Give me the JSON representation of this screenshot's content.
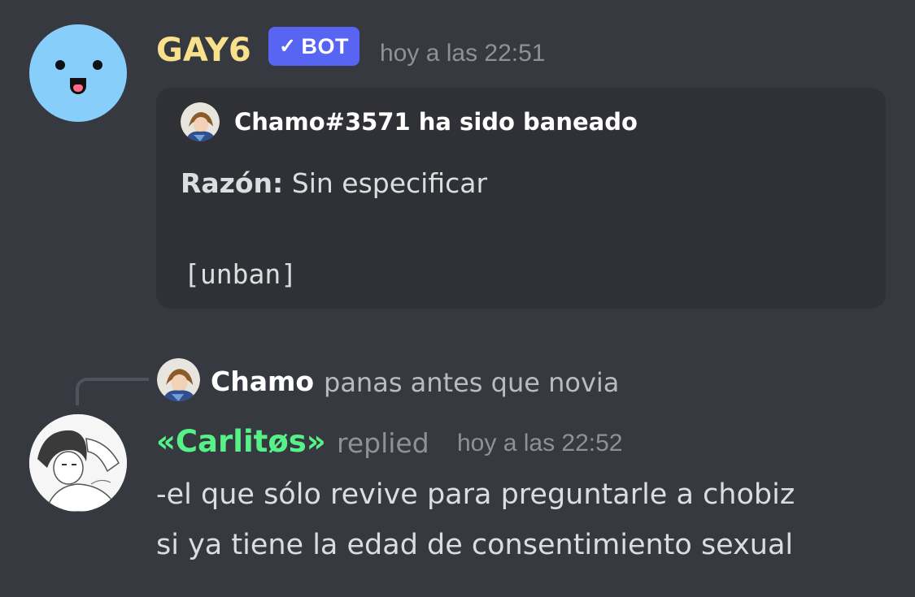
{
  "message1": {
    "author": "GAY6",
    "badge": "BOT",
    "timestamp": "hoy a las 22:51",
    "avatar_icon": "smiley-face-icon",
    "embed": {
      "author": "Chamo#3571 ha sido baneado",
      "description_label": "Razón:",
      "description_value": "Sin especificar",
      "footer_code": "[unban]"
    }
  },
  "reply_reference": {
    "author": "Chamo",
    "content": "panas antes que novia"
  },
  "message2": {
    "author": "«Carlitøs»",
    "replied_label": "replied",
    "timestamp": "hoy a las 22:52",
    "lines": [
      "-el que sólo revive para preguntarle a chobiz",
      "si ya tiene la edad de consentimiento sexual"
    ]
  },
  "colors": {
    "background": "#36393f",
    "embed_background": "#2f3136",
    "bot_name": "#f8e08d",
    "bot_badge": "#5865f2",
    "user_name": "#57f287",
    "muted": "#8e9297"
  }
}
